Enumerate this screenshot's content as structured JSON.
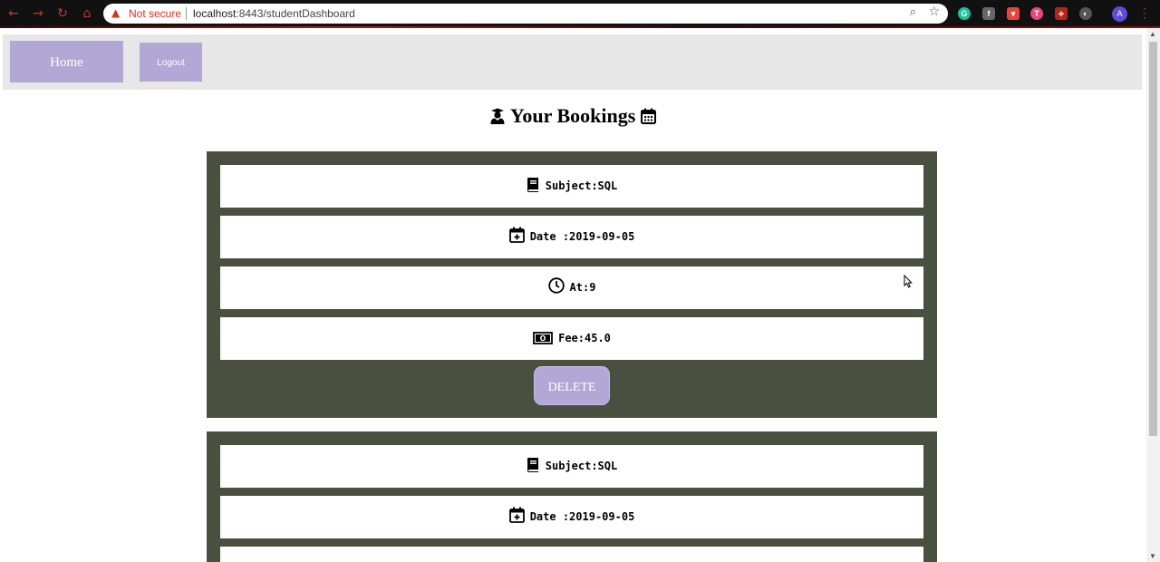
{
  "browser": {
    "warning_label": "Not secure",
    "url_host": "localhost",
    "url_rest": ":8443/studentDashboard",
    "avatar_letter": "A"
  },
  "navbar": {
    "home_label": "Home",
    "logout_label": "Logout"
  },
  "page": {
    "title": "Your Bookings"
  },
  "bookings": [
    {
      "subject": "Subject:SQL",
      "date": "Date :2019-09-05",
      "time": "At:9",
      "fee": "Fee:45.0",
      "delete_label": "DELETE"
    },
    {
      "subject": "Subject:SQL",
      "date": "Date :2019-09-05"
    }
  ],
  "colors": {
    "accent": "#b3a7d5",
    "card_bg": "#4a5040",
    "navbar_bg": "#e7e7e7"
  }
}
